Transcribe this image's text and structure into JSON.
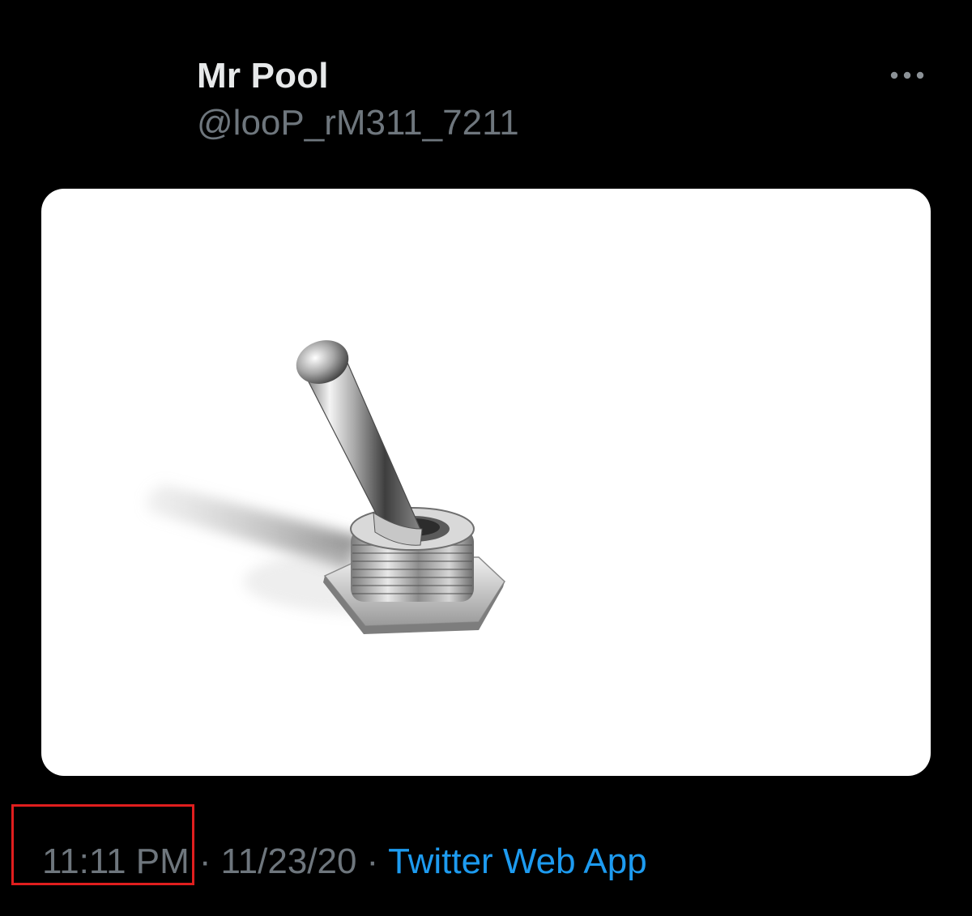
{
  "tweet": {
    "display_name": "Mr Pool",
    "handle": "@looP_rM311_7211",
    "time": "11:11 PM",
    "separator": "·",
    "date": "11/23/20",
    "source": "Twitter Web App"
  },
  "media": {
    "subject": "toggle-switch-image"
  },
  "icons": {
    "more": "more-horizontal-icon"
  },
  "colors": {
    "background": "#000000",
    "name": "#e7e9ea",
    "secondary_text": "#6e767d",
    "link": "#1d9bf0",
    "annotation": "#e01e1e"
  }
}
